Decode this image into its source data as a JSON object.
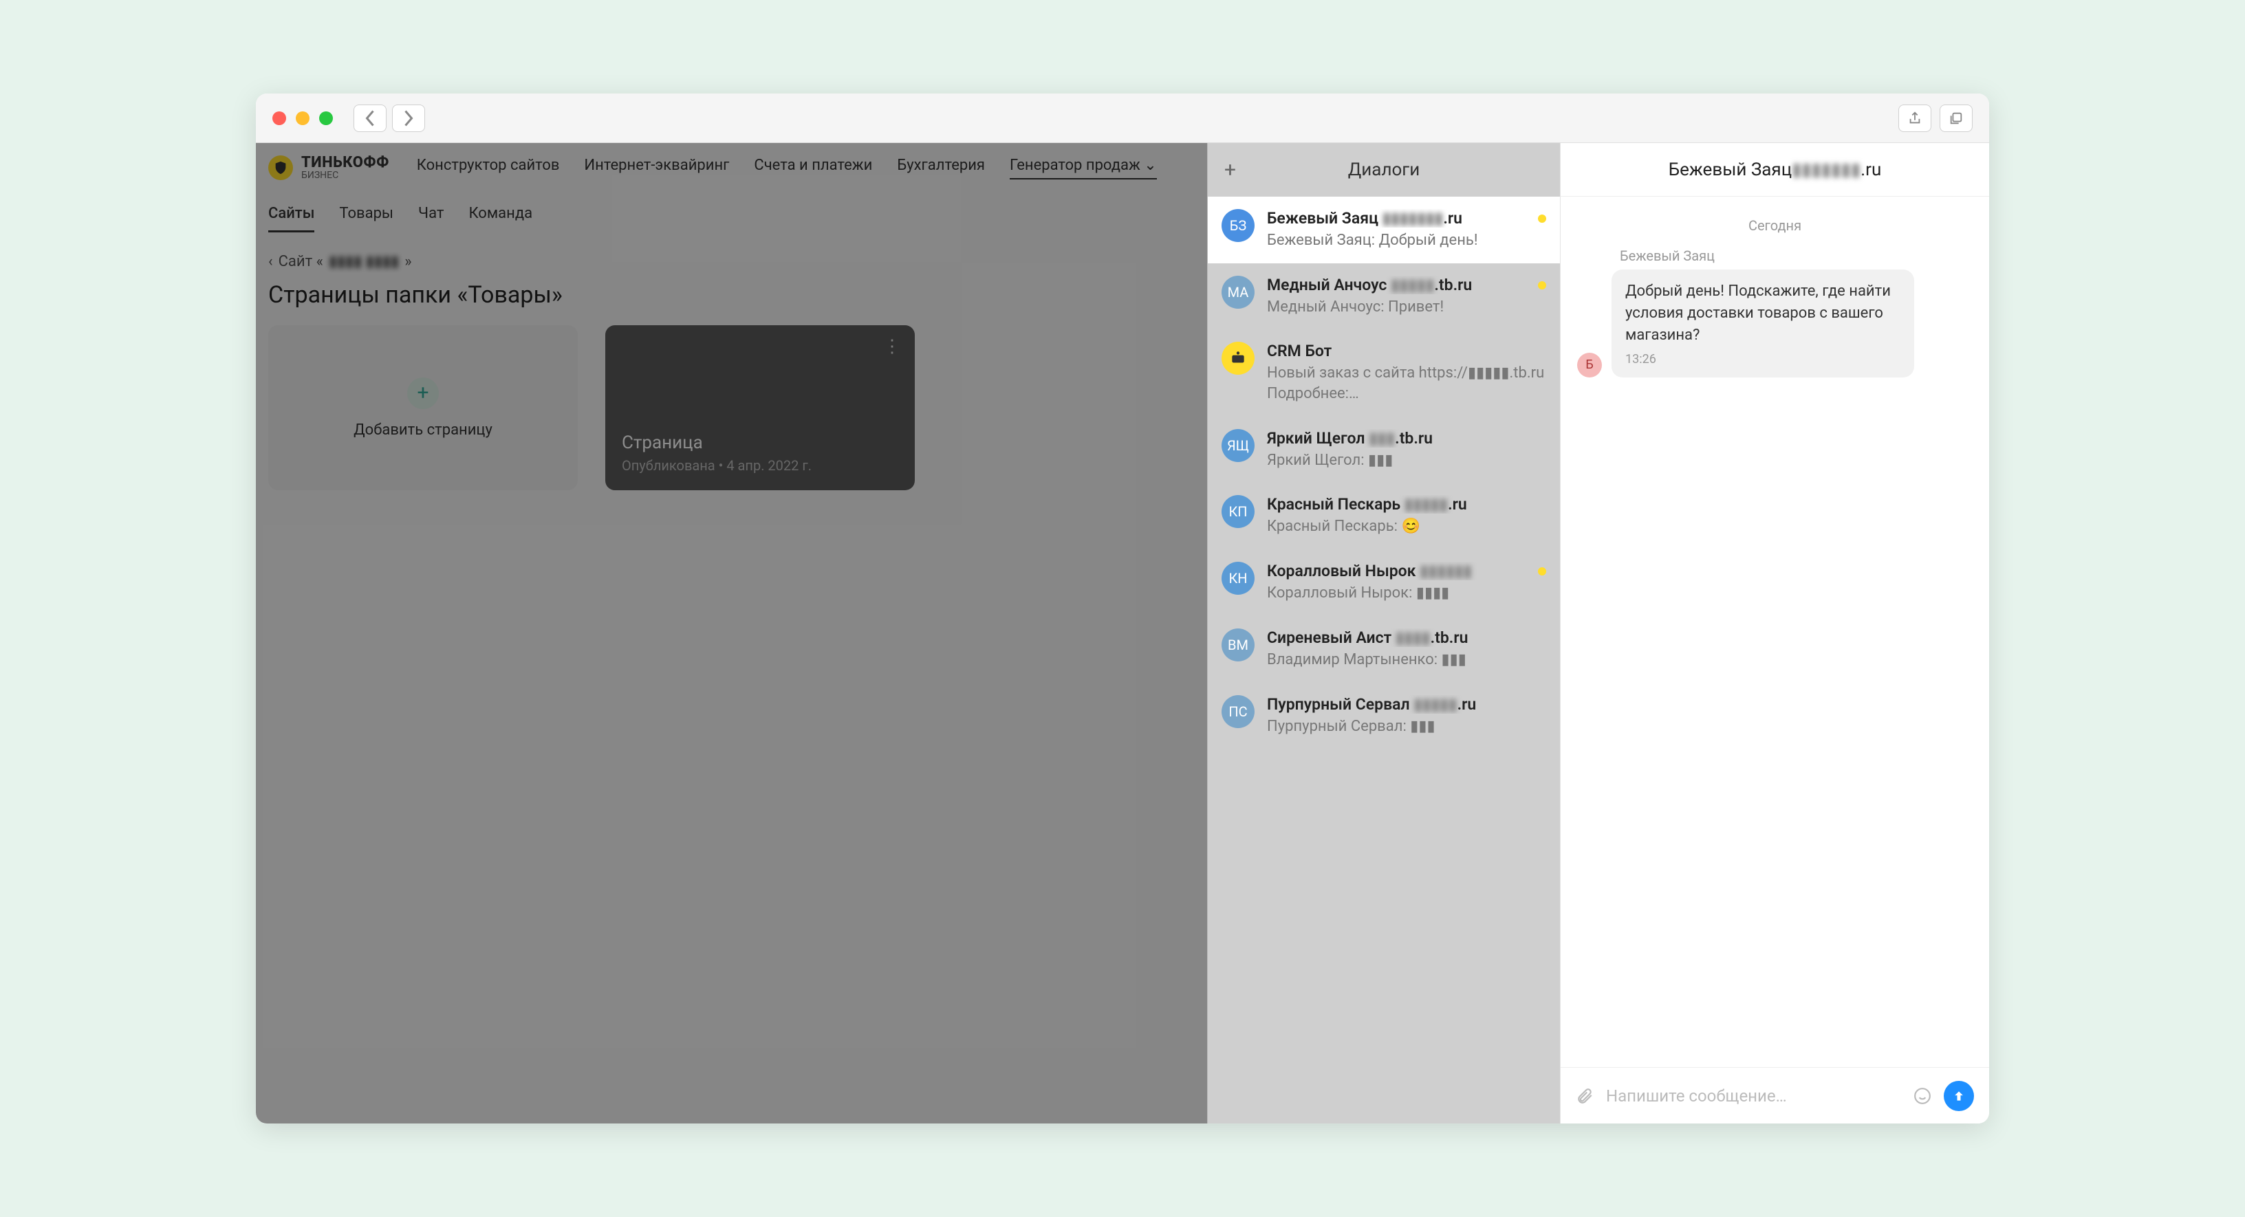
{
  "titlebar": {
    "share": "share",
    "tabs": "tabs"
  },
  "brand": {
    "name": "ТИНЬКОФФ",
    "sub": "БИЗНЕС"
  },
  "topnav": {
    "items": [
      {
        "label": "Конструктор сайтов"
      },
      {
        "label": "Интернет-эквайринг"
      },
      {
        "label": "Счета и платежи"
      },
      {
        "label": "Бухгалтерия"
      },
      {
        "label": "Генератор продаж"
      }
    ]
  },
  "subnav": {
    "items": [
      {
        "label": "Сайты"
      },
      {
        "label": "Товары"
      },
      {
        "label": "Чат"
      },
      {
        "label": "Команда"
      }
    ]
  },
  "crumb": {
    "prefix": "Сайт «",
    "masked": "▮▮▮▮ ▮▮▮▮",
    "suffix": "»"
  },
  "page_title": "Страницы папки «Товары»",
  "cards": {
    "add": "Добавить страницу",
    "page": {
      "title": "Страница",
      "sub": "Опубликована • 4 апр. 2022 г."
    }
  },
  "dialogs": {
    "title": "Диалоги",
    "items": [
      {
        "initials": "БЗ",
        "color": "#4a90e2",
        "name": "Бежевый Заяц ",
        "masked": "▮▮▮▮▮▮▮",
        "suffix": ".ru",
        "preview": "Бежевый Заяц: Добрый день!",
        "unread": true,
        "active": true
      },
      {
        "initials": "МА",
        "color": "#7aa6c9",
        "name": "Медный Анчоус ",
        "masked": "▮▮▮▮▮",
        "suffix": ".tb.ru",
        "preview": "Медный Анчоус: Привет!",
        "unread": true
      },
      {
        "initials": "",
        "color": "#ffdd2d",
        "name": "CRM Бот",
        "masked": "",
        "suffix": "",
        "preview": "Новый заказ с сайта https://▮▮▮▮▮.tb.ru Подробнее:…",
        "bot": true
      },
      {
        "initials": "ЯЩ",
        "color": "#5b9bd5",
        "name": "Яркий Щегол ",
        "masked": "▮▮▮",
        "suffix": ".tb.ru",
        "preview": "Яркий Щегол: ▮▮▮"
      },
      {
        "initials": "КП",
        "color": "#5b9bd5",
        "name": "Красный Пескарь ",
        "masked": "▮▮▮▮▮",
        "suffix": ".ru",
        "preview": "Красный Пескарь: 😊"
      },
      {
        "initials": "КН",
        "color": "#5b9bd5",
        "name": "Коралловый Нырок ",
        "masked": "▮▮▮▮▮▮",
        "suffix": "",
        "preview": "Коралловый Нырок: ▮▮▮▮",
        "unread": true
      },
      {
        "initials": "ВМ",
        "color": "#7aa6c9",
        "name": "Сиреневый Аист ",
        "masked": "▮▮▮▮",
        "suffix": ".tb.ru",
        "preview": "Владимир Мартыненко: ▮▮▮"
      },
      {
        "initials": "ПС",
        "color": "#7aa6c9",
        "name": "Пурпурный Сервал ",
        "masked": "▮▮▮▮▮",
        "suffix": ".ru",
        "preview": "Пурпурный Сервал: ▮▮▮"
      }
    ]
  },
  "chat": {
    "title_name": "Бежевый Заяц ",
    "title_masked": "▮▮▮▮▮▮▮",
    "title_suffix": ".ru",
    "date": "Сегодня",
    "author": "Бежевый Заяц",
    "msg": "Добрый день! Подскажите, где найти условия доставки товаров с вашего магазина?",
    "time": "13:26",
    "avatar": "Б",
    "placeholder": "Напишите сообщение…"
  }
}
